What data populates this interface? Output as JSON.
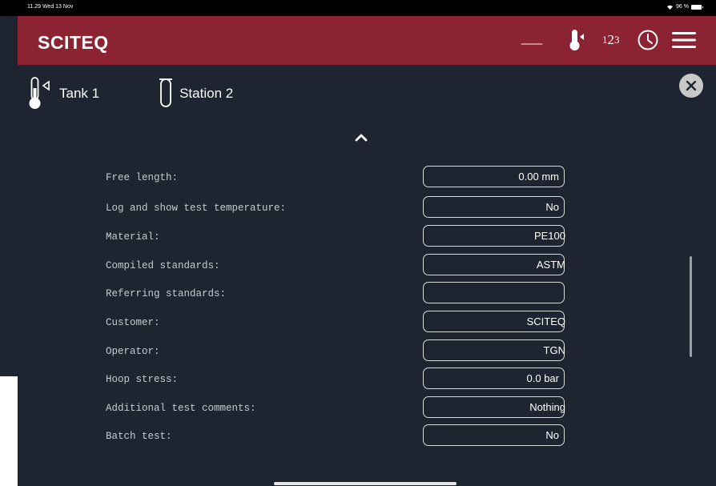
{
  "status": {
    "time_date": "11.29  Wed 13 Nov",
    "battery": "96 %"
  },
  "header": {
    "brand": "SCITEQ",
    "dashes": "---------",
    "icons": [
      "thermometer-icon",
      "number-order-icon",
      "clock-icon",
      "menu-icon"
    ]
  },
  "info": {
    "tank": "Tank 1",
    "station": "Station 2"
  },
  "fields": [
    {
      "label": "Free length:",
      "value": "0.00 mm"
    },
    {
      "label": "Log and show test temperature:",
      "value": "No"
    },
    {
      "label": "Material:",
      "value": "PE100"
    },
    {
      "label": "Compiled standards:",
      "value": "ASTM"
    },
    {
      "label": "Referring standards:",
      "value": ""
    },
    {
      "label": "Customer:",
      "value": "SCITEQ"
    },
    {
      "label": "Operator:",
      "value": "TGN"
    },
    {
      "label": "Hoop stress:",
      "value": "0.0 bar"
    },
    {
      "label": "Additional test comments:",
      "value": "Nothing"
    },
    {
      "label": "Batch test:",
      "value": "No"
    }
  ]
}
